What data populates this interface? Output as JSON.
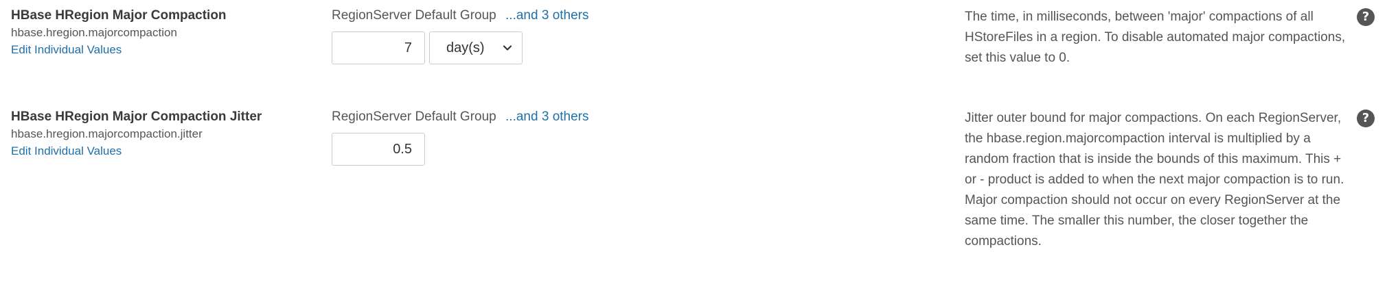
{
  "properties": [
    {
      "title": "HBase HRegion Major Compaction",
      "key": "hbase.hregion.majorcompaction",
      "edit_label": "Edit Individual Values",
      "group": "RegionServer Default Group",
      "others": "...and 3 others",
      "value": "7",
      "unit": "day(s)",
      "description": "The time, in milliseconds, between 'major' compactions of all HStoreFiles in a region. To disable automated major compactions, set this value to 0.",
      "help_glyph": "?"
    },
    {
      "title": "HBase HRegion Major Compaction Jitter",
      "key": "hbase.hregion.majorcompaction.jitter",
      "edit_label": "Edit Individual Values",
      "group": "RegionServer Default Group",
      "others": "...and 3 others",
      "value": "0.5",
      "description": "Jitter outer bound for major compactions. On each RegionServer, the hbase.region.majorcompaction interval is multiplied by a random fraction that is inside the bounds of this maximum. This + or - product is added to when the next major compaction is to run. Major compaction should not occur on every RegionServer at the same time. The smaller this number, the closer together the compactions.",
      "help_glyph": "?"
    }
  ],
  "icons": {
    "help": "help-circle-icon",
    "dropdown": "chevron-down-icon"
  },
  "colors": {
    "link": "#1f6fa8",
    "text": "#555555",
    "help_bg": "#555555"
  }
}
